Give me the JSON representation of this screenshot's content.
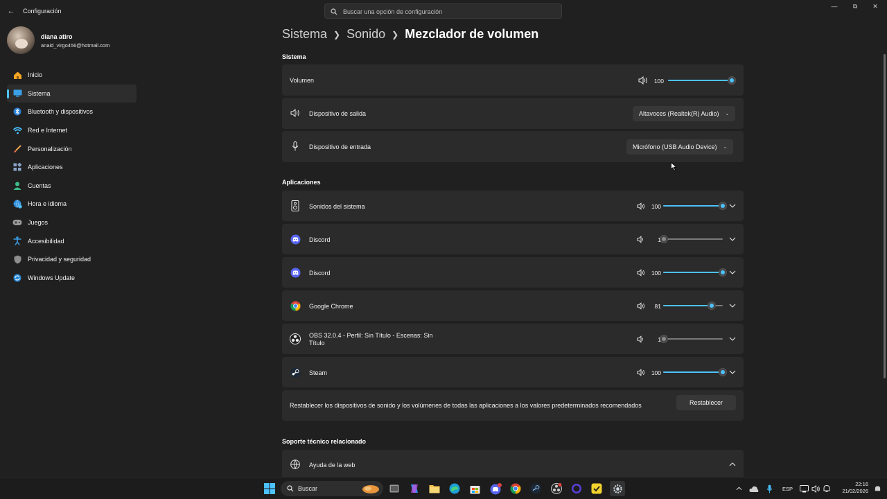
{
  "window": {
    "app_title": "Configuración",
    "search_placeholder": "Buscar una opción de configuración"
  },
  "profile": {
    "name": "diana atiro",
    "email": "anaid_virgo456@hotmail.com"
  },
  "sidebar": {
    "items": [
      {
        "label": "Inicio",
        "icon": "home-icon"
      },
      {
        "label": "Sistema",
        "icon": "system-icon",
        "active": true
      },
      {
        "label": "Bluetooth y dispositivos",
        "icon": "bluetooth-icon"
      },
      {
        "label": "Red e Internet",
        "icon": "wifi-icon"
      },
      {
        "label": "Personalización",
        "icon": "brush-icon"
      },
      {
        "label": "Aplicaciones",
        "icon": "apps-icon"
      },
      {
        "label": "Cuentas",
        "icon": "person-icon"
      },
      {
        "label": "Hora e idioma",
        "icon": "globe-clock-icon"
      },
      {
        "label": "Juegos",
        "icon": "gamepad-icon"
      },
      {
        "label": "Accesibilidad",
        "icon": "accessibility-icon"
      },
      {
        "label": "Privacidad y seguridad",
        "icon": "shield-icon"
      },
      {
        "label": "Windows Update",
        "icon": "update-icon"
      }
    ]
  },
  "breadcrumb": {
    "items": [
      "Sistema",
      "Sonido"
    ],
    "current": "Mezclador de volumen"
  },
  "system": {
    "title": "Sistema",
    "volume_label": "Volumen",
    "volume_value": "100",
    "volume_level": 1.0,
    "output_label": "Dispositivo de salida",
    "output_value": "Altavoces (Realtek(R) Audio)",
    "input_label": "Dispositivo de entrada",
    "input_value": "Micrófono (USB Audio Device)"
  },
  "apps": {
    "title": "Aplicaciones",
    "items": [
      {
        "name": "Sonidos del sistema",
        "value": "100",
        "level": 1.0,
        "icon": "system-sounds-icon"
      },
      {
        "name": "Discord",
        "value": "1",
        "level": 0.01,
        "icon": "discord-icon"
      },
      {
        "name": "Discord",
        "value": "100",
        "level": 1.0,
        "icon": "discord-icon"
      },
      {
        "name": "Google Chrome",
        "value": "81",
        "level": 0.81,
        "icon": "chrome-icon"
      },
      {
        "name": "OBS 32.0.4 - Perfil: Sin Título - Escenas: Sin Título",
        "value": "1",
        "level": 0.01,
        "icon": "obs-icon"
      },
      {
        "name": "Steam",
        "value": "100",
        "level": 1.0,
        "icon": "steam-icon"
      }
    ],
    "reset_text": "Restablecer los dispositivos de sonido y los volúmenes de todas las aplicaciones a los valores predeterminados recomendados",
    "reset_button": "Restablecer"
  },
  "support": {
    "title": "Soporte técnico relacionado",
    "web_help": "Ayuda de la web"
  },
  "taskbar": {
    "search_label": "Buscar",
    "language": "ESP",
    "time": "22:16",
    "date": "21/02/2026"
  },
  "colors": {
    "accent": "#4cc2ff",
    "background": "#202020",
    "card": "#2b2b2b"
  }
}
